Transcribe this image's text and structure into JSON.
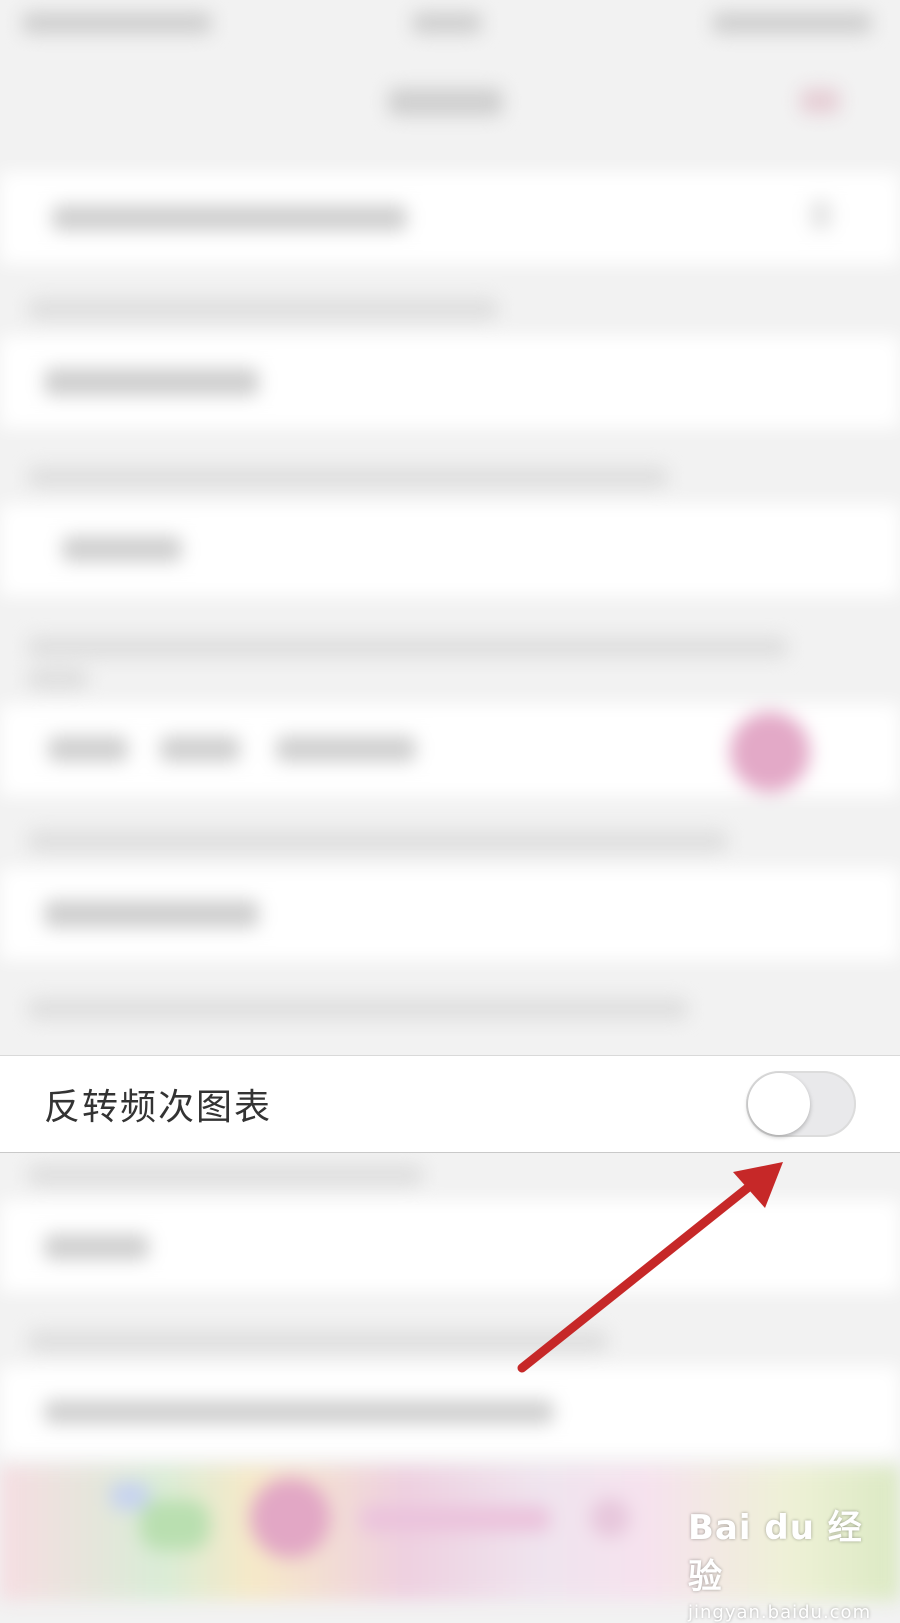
{
  "setting_row": {
    "label": "反转频次图表",
    "toggle_on": false
  },
  "annotation": {
    "arrow_color": "#c62828"
  },
  "watermark": {
    "brand": "Bai du 经验",
    "url": "jingyan.baidu.com"
  }
}
